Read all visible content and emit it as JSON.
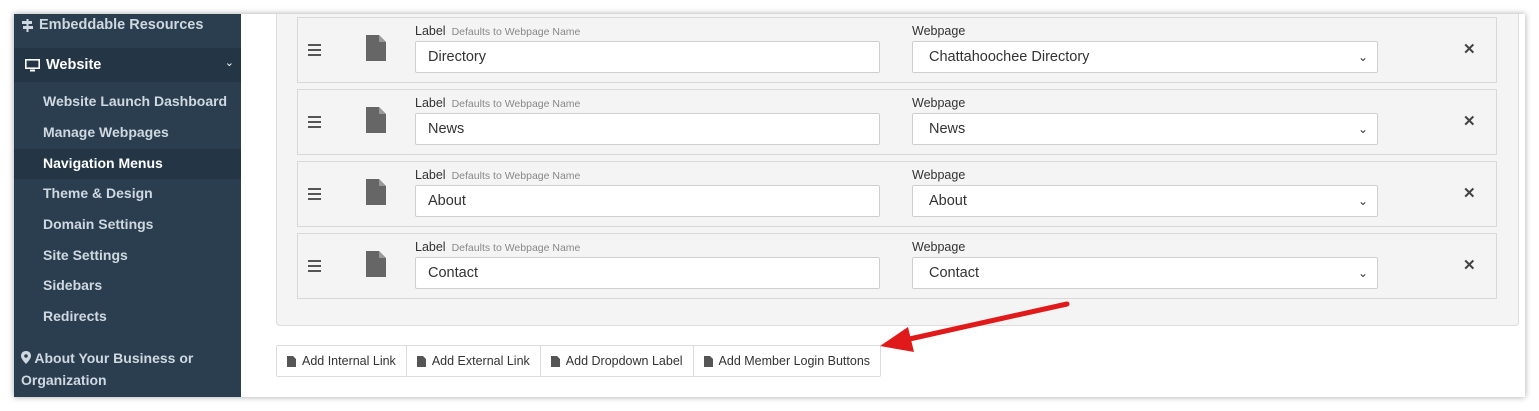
{
  "sidebar": {
    "top_item": "Embeddable Resources",
    "section": "Website",
    "sub_items": [
      {
        "label": "Website Launch Dashboard",
        "active": false
      },
      {
        "label": "Manage Webpages",
        "active": false
      },
      {
        "label": "Navigation Menus",
        "active": true
      },
      {
        "label": "Theme & Design",
        "active": false
      },
      {
        "label": "Domain Settings",
        "active": false
      },
      {
        "label": "Site Settings",
        "active": false
      },
      {
        "label": "Sidebars",
        "active": false
      },
      {
        "label": "Redirects",
        "active": false
      }
    ],
    "bottom_item": "About Your Business or Organization"
  },
  "menu_rows": [
    {
      "label_title": "Label",
      "label_hint": "Defaults to Webpage Name",
      "label_value": "Directory",
      "webpage_title": "Webpage",
      "webpage_value": "Chattahoochee Directory"
    },
    {
      "label_title": "Label",
      "label_hint": "Defaults to Webpage Name",
      "label_value": "News",
      "webpage_title": "Webpage",
      "webpage_value": "News"
    },
    {
      "label_title": "Label",
      "label_hint": "Defaults to Webpage Name",
      "label_value": "About",
      "webpage_title": "Webpage",
      "webpage_value": "About"
    },
    {
      "label_title": "Label",
      "label_hint": "Defaults to Webpage Name",
      "label_value": "Contact",
      "webpage_title": "Webpage",
      "webpage_value": "Contact"
    }
  ],
  "actions": {
    "add_internal": "Add Internal Link",
    "add_external": "Add External Link",
    "add_dropdown": "Add Dropdown Label",
    "add_member_login": "Add Member Login Buttons"
  },
  "colors": {
    "sidebar_bg": "#2b3e50",
    "annotation_arrow": "#e01a1a"
  }
}
